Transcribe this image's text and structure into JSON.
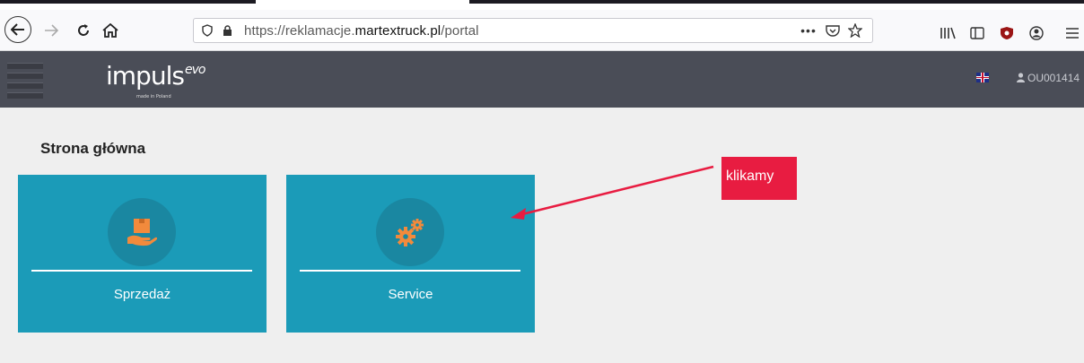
{
  "browser": {
    "url_prefix": "https://reklamacje.",
    "url_domain": "martextruck.pl",
    "url_path": "/portal"
  },
  "header": {
    "logo_text": "impuls",
    "logo_super": "evo",
    "logo_tag": "made in Poland",
    "user_label": "OU001414"
  },
  "main": {
    "page_title": "Strona główna",
    "tiles": [
      {
        "label": "Sprzedaż",
        "icon": "box-in-hand-icon"
      },
      {
        "label": "Service",
        "icon": "gears-icon"
      }
    ]
  },
  "annotation": {
    "text": "klikamy",
    "color": "#e81c41"
  },
  "colors": {
    "tile": "#1b9bb8",
    "header": "#4a4d57",
    "icon_orange": "#f28a3c"
  }
}
